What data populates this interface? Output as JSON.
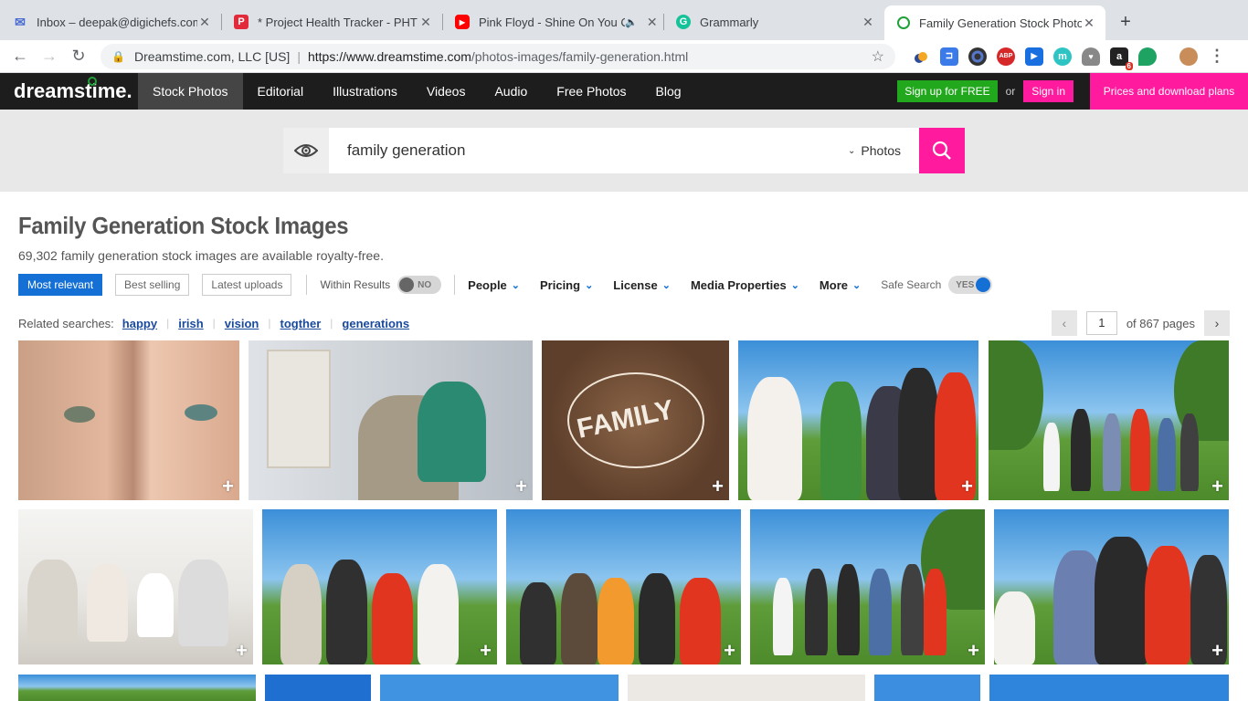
{
  "browser": {
    "tabs": [
      {
        "title": "Inbox – deepak@digichefs.com",
        "icon": "mail-icon",
        "color": "#4a6cd4",
        "active": false
      },
      {
        "title": "* Project Health Tracker - PHT",
        "icon": "tracker-icon",
        "color": "#e22a3b",
        "active": false
      },
      {
        "title": "Pink Floyd - Shine On You Crazy Diamond",
        "icon": "youtube-icon",
        "color": "#ff0000",
        "active": false,
        "audio": true
      },
      {
        "title": "Grammarly",
        "icon": "grammarly-icon",
        "color": "#15c39a",
        "active": false
      },
      {
        "title": "Family Generation Stock Photos",
        "icon": "dreamstime-icon",
        "color": "#21a038",
        "active": true
      }
    ],
    "address": {
      "org": "Dreamstime.com, LLC [US]",
      "url_prefix": "https://www.dreamstime.com",
      "url_path": "/photos-images/family-generation.html"
    },
    "extensions": [
      "ext-1-icon",
      "ext-2-icon",
      "ext-3-icon",
      "adblock-icon",
      "ext-5-icon",
      "ext-6-icon",
      "ext-7-icon",
      "ext-8-icon",
      "ext-9-icon",
      "avatar-icon"
    ],
    "ext_badge": "6",
    "abp_label": "ABP",
    "m_label": "m"
  },
  "site": {
    "logo": "dreamstime.",
    "nav": [
      "Stock Photos",
      "Editorial",
      "Illustrations",
      "Videos",
      "Audio",
      "Free Photos",
      "Blog"
    ],
    "signup": "Sign up for FREE",
    "or": "or",
    "signin": "Sign in",
    "prices": "Prices and download plans",
    "accent": "#ff1a9e",
    "green": "#21a81c"
  },
  "search": {
    "value": "family generation",
    "type": "Photos"
  },
  "page": {
    "title": "Family Generation Stock Images",
    "subtitle": "69,302 family generation stock images are available royalty-free."
  },
  "filters": {
    "sort": [
      "Most relevant",
      "Best selling",
      "Latest uploads"
    ],
    "within_label": "Within Results",
    "within_value": "NO",
    "dropdowns": [
      "People",
      "Pricing",
      "License",
      "Media Properties",
      "More"
    ],
    "safe_label": "Safe Search",
    "safe_value": "YES"
  },
  "related": {
    "label": "Related searches:",
    "terms": [
      "happy",
      "irish",
      "vision",
      "togther",
      "generations"
    ]
  },
  "pager": {
    "current": "1",
    "of_text": "of 867 pages"
  },
  "plus": "+"
}
